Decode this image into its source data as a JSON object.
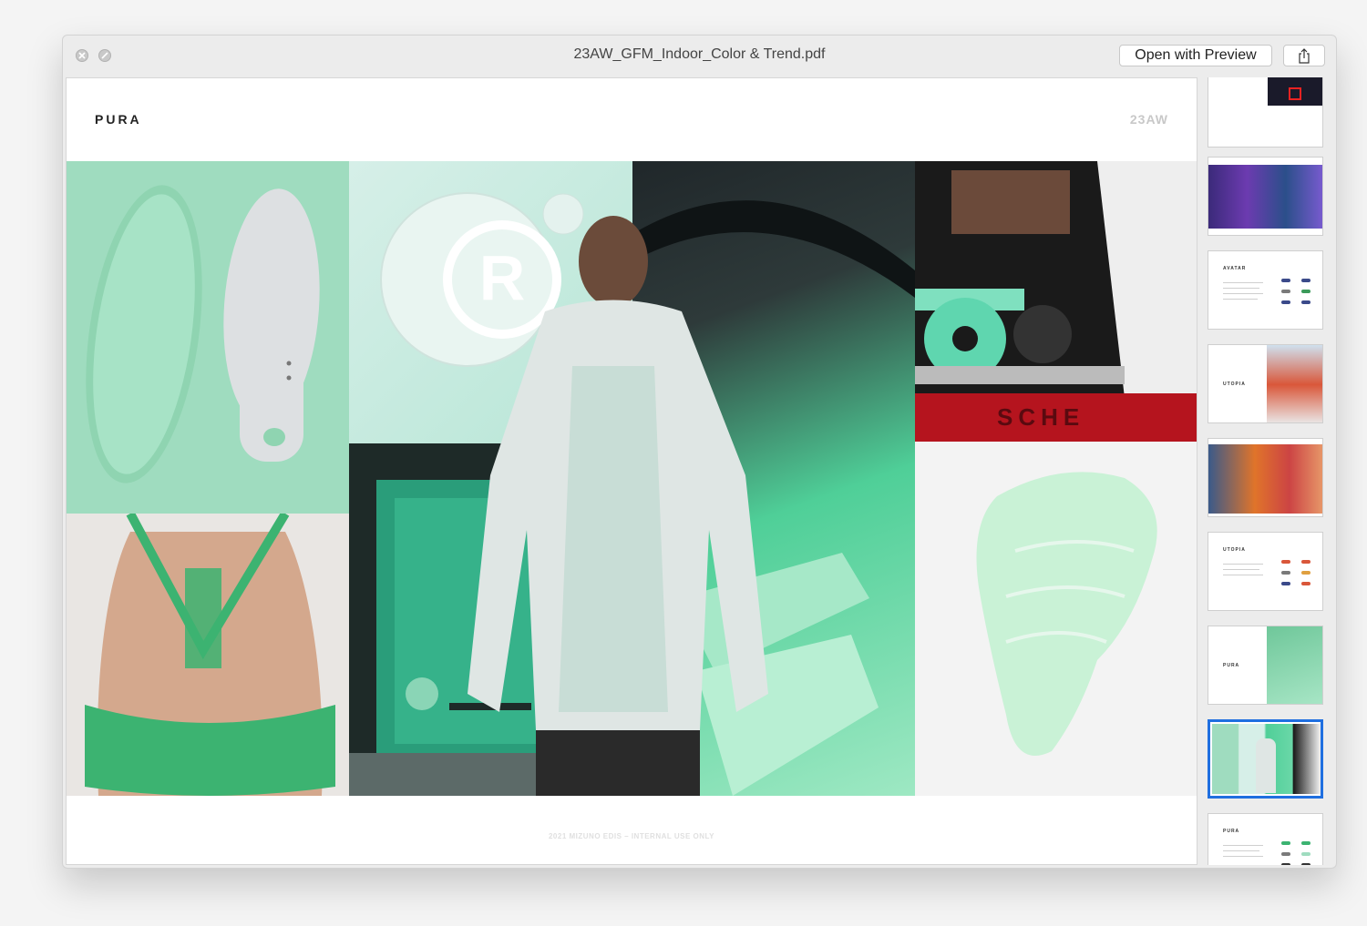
{
  "window": {
    "title": "23AW_GFM_Indoor_Color & Trend.pdf",
    "open_with_preview_label": "Open with Preview"
  },
  "page": {
    "brand": "PURA",
    "season": "23AW",
    "footer": "2021 MIZUNO EDIS – INTERNAL USE ONLY"
  },
  "thumbnails": [
    {
      "label": ""
    },
    {
      "label": ""
    },
    {
      "label": "AVATAR"
    },
    {
      "label": "UTOPIA"
    },
    {
      "label": ""
    },
    {
      "label": "UTOPIA"
    },
    {
      "label": "PURA"
    },
    {
      "label": "",
      "selected": true
    },
    {
      "label": "PURA"
    }
  ],
  "colors": {
    "mint": "#9fdcbf",
    "green_accent": "#3cb371",
    "selection": "#1f6fe0"
  }
}
